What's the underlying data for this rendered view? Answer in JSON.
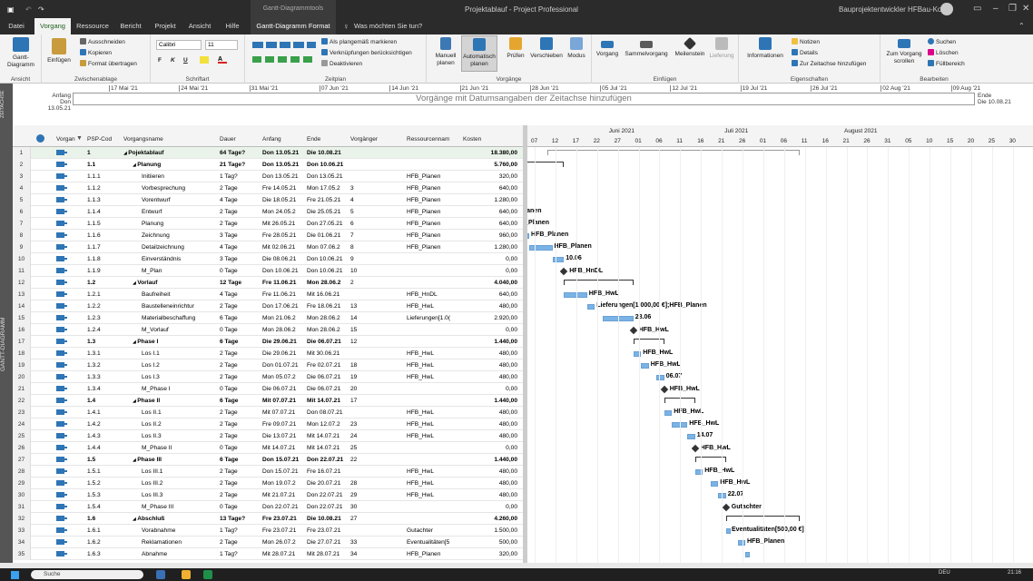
{
  "title_bar": {
    "context_label": "Gantt-Diagrammtools",
    "doc_title": "Projektablauf - Project Professional",
    "user": "Bauprojektentwickler HFBau-Kosel"
  },
  "tabs": [
    "Datei",
    "Vorgang",
    "Ressource",
    "Bericht",
    "Projekt",
    "Ansicht",
    "Hilfe",
    "Gantt-Diagramm Format"
  ],
  "tell_me": "Was möchten Sie tun?",
  "ribbon": {
    "ansicht": {
      "btn": "Gantt-Diagramm",
      "label": "Ansicht"
    },
    "zwischen": {
      "einfuegen": "Einfügen",
      "aus": "Ausschneiden",
      "kop": "Kopieren",
      "fmt": "Format übertragen",
      "label": "Zwischenablage"
    },
    "schrift": {
      "font": "Calibri",
      "size": "11",
      "b": "F",
      "i": "K",
      "u": "U",
      "label": "Schriftart"
    },
    "zeitplan": {
      "a": "Als plangemäß markieren",
      "b": "Verknüpfungen berücksichtigen",
      "c": "Deaktivieren",
      "label": "Zeitplan"
    },
    "vorgaenge": {
      "manuell": "Manuell planen",
      "auto": "Automatisch planen",
      "pruefen": "Prüfen",
      "versch": "Verschieben",
      "modus": "Modus",
      "label": "Vorgänge"
    },
    "einfuegen": {
      "vorgang": "Vorgang",
      "sammel": "Sammelvorgang",
      "meilen": "Meilenstein",
      "lief": "Lieferung",
      "label": "Einfügen"
    },
    "eigen": {
      "info": "Informationen",
      "notizen": "Notizen",
      "details": "Details",
      "zeit": "Zur Zeitachse hinzufügen",
      "label": "Eigenschaften"
    },
    "bearb": {
      "zum": "Zum Vorgang scrollen",
      "suchen": "Suchen",
      "loeschen": "Löschen",
      "fuell": "Füllbereich",
      "label": "Bearbeiten"
    }
  },
  "timeline": {
    "side": "ZEITACHSE",
    "anfang_label": "Anfang",
    "anfang": "Don 13.05.21",
    "ende_label": "Ende",
    "ende": "Die 10.08.21",
    "placeholder": "Vorgänge mit Datumsangaben der Zeitachse hinzufügen",
    "ticks": [
      "17 Mai '21",
      "24 Mai '21",
      "31 Mai '21",
      "07 Jun '21",
      "14 Jun '21",
      "21 Jun '21",
      "28 Jun '21",
      "05 Jul '21",
      "12 Jul '21",
      "19 Jul '21",
      "26 Jul '21",
      "02 Aug '21",
      "09 Aug '21"
    ]
  },
  "view_side": "GANTT-DIAGRAMM",
  "columns": [
    "Vorgan",
    "PSP-Cod",
    "Vorgangsname",
    "Dauer",
    "Anfang",
    "Ende",
    "Vorgänger",
    "Ressourcennam",
    "Kosten"
  ],
  "rows": [
    [
      "1",
      "1",
      "Pojektablauf",
      "64 Tage?",
      "Don 13.05.21",
      "Die 10.08.21",
      "",
      "",
      "18.380,00",
      0,
      1
    ],
    [
      "2",
      "1.1",
      "Planung",
      "21 Tage?",
      "Don 13.05.21",
      "Don 10.06.21",
      "",
      "",
      "5.760,00",
      1,
      1
    ],
    [
      "3",
      "1.1.1",
      "Initiieren",
      "1 Tag?",
      "Don 13.05.21",
      "Don 13.05.21",
      "",
      "HFB_Planen",
      "320,00",
      2,
      0
    ],
    [
      "4",
      "1.1.2",
      "Vorbesprechung",
      "2 Tage",
      "Fre 14.05.21",
      "Mon 17.05.2",
      "3",
      "HFB_Planen",
      "640,00",
      2,
      0
    ],
    [
      "5",
      "1.1.3",
      "Vorentwurf",
      "4 Tage",
      "Die 18.05.21",
      "Fre 21.05.21",
      "4",
      "HFB_Planen",
      "1.280,00",
      2,
      0
    ],
    [
      "6",
      "1.1.4",
      "Entwurf",
      "2 Tage",
      "Mon 24.05.2",
      "Die 25.05.21",
      "5",
      "HFB_Planen",
      "640,00",
      2,
      0
    ],
    [
      "7",
      "1.1.5",
      "Planung",
      "2 Tage",
      "Mit 26.05.21",
      "Don 27.05.21",
      "6",
      "HFB_Planen",
      "640,00",
      2,
      0
    ],
    [
      "8",
      "1.1.6",
      "Zeichnung",
      "3 Tage",
      "Fre 28.05.21",
      "Die 01.06.21",
      "7",
      "HFB_Planen",
      "960,00",
      2,
      0
    ],
    [
      "9",
      "1.1.7",
      "Detailzeichnung",
      "4 Tage",
      "Mit 02.06.21",
      "Mon 07.06.2",
      "8",
      "HFB_Planen",
      "1.280,00",
      2,
      0
    ],
    [
      "10",
      "1.1.8",
      "Einverständnis",
      "3 Tage",
      "Die 08.06.21",
      "Don 10.06.21",
      "9",
      "",
      "0,00",
      2,
      0
    ],
    [
      "11",
      "1.1.9",
      "M_Plan",
      "0 Tage",
      "Don 10.06.21",
      "Don 10.06.21",
      "10",
      "",
      "0,00",
      2,
      0
    ],
    [
      "12",
      "1.2",
      "Vorlauf",
      "12 Tage",
      "Fre 11.06.21",
      "Mon 28.06.2",
      "2",
      "",
      "4.040,00",
      1,
      1
    ],
    [
      "13",
      "1.2.1",
      "Baufreiheit",
      "4 Tage",
      "Fre 11.06.21",
      "Mit 16.06.21",
      "",
      "HFB_HnDL",
      "640,00",
      2,
      0
    ],
    [
      "14",
      "1.2.2",
      "Baustelleneinrichtur",
      "2 Tage",
      "Don 17.06.21",
      "Fre 18.06.21",
      "13",
      "HFB_HwL",
      "480,00",
      2,
      0
    ],
    [
      "15",
      "1.2.3",
      "Materialbeschaffung",
      "6 Tage",
      "Mon 21.06.2",
      "Mon 28.06.2",
      "14",
      "Lieferungen[1.0(",
      "2.920,00",
      2,
      0
    ],
    [
      "16",
      "1.2.4",
      "M_Vorlauf",
      "0 Tage",
      "Mon 28.06.2",
      "Mon 28.06.2",
      "15",
      "",
      "0,00",
      2,
      0
    ],
    [
      "17",
      "1.3",
      "Phase I",
      "6 Tage",
      "Die 29.06.21",
      "Die 06.07.21",
      "12",
      "",
      "1.440,00",
      1,
      1
    ],
    [
      "18",
      "1.3.1",
      "Los I.1",
      "2 Tage",
      "Die 29.06.21",
      "Mit 30.06.21",
      "",
      "HFB_HwL",
      "480,00",
      2,
      0
    ],
    [
      "19",
      "1.3.2",
      "Los I.2",
      "2 Tage",
      "Don 01.07.21",
      "Fre 02.07.21",
      "18",
      "HFB_HwL",
      "480,00",
      2,
      0
    ],
    [
      "20",
      "1.3.3",
      "Los I.3",
      "2 Tage",
      "Mon 05.07.2",
      "Die 06.07.21",
      "19",
      "HFB_HwL",
      "480,00",
      2,
      0
    ],
    [
      "21",
      "1.3.4",
      "M_Phase I",
      "0 Tage",
      "Die 06.07.21",
      "Die 06.07.21",
      "20",
      "",
      "0,00",
      2,
      0
    ],
    [
      "22",
      "1.4",
      "Phase II",
      "6 Tage",
      "Mit 07.07.21",
      "Mit 14.07.21",
      "17",
      "",
      "1.440,00",
      1,
      1
    ],
    [
      "23",
      "1.4.1",
      "Los II.1",
      "2 Tage",
      "Mit 07.07.21",
      "Don 08.07.21",
      "",
      "HFB_HwL",
      "480,00",
      2,
      0
    ],
    [
      "24",
      "1.4.2",
      "Los II.2",
      "2 Tage",
      "Fre 09.07.21",
      "Mon 12.07.2",
      "23",
      "HFB_HwL",
      "480,00",
      2,
      0
    ],
    [
      "25",
      "1.4.3",
      "Los II.3",
      "2 Tage",
      "Die 13.07.21",
      "Mit 14.07.21",
      "24",
      "HFB_HwL",
      "480,00",
      2,
      0
    ],
    [
      "26",
      "1.4.4",
      "M_Phase II",
      "0 Tage",
      "Mit 14.07.21",
      "Mit 14.07.21",
      "25",
      "",
      "0,00",
      2,
      0
    ],
    [
      "27",
      "1.5",
      "Phase III",
      "6 Tage",
      "Don 15.07.21",
      "Don 22.07.21",
      "22",
      "",
      "1.440,00",
      1,
      1
    ],
    [
      "28",
      "1.5.1",
      "Los III.1",
      "2 Tage",
      "Don 15.07.21",
      "Fre 16.07.21",
      "",
      "HFB_HwL",
      "480,00",
      2,
      0
    ],
    [
      "29",
      "1.5.2",
      "Los III.2",
      "2 Tage",
      "Mon 19.07.2",
      "Die 20.07.21",
      "28",
      "HFB_HwL",
      "480,00",
      2,
      0
    ],
    [
      "30",
      "1.5.3",
      "Los III.3",
      "2 Tage",
      "Mit 21.07.21",
      "Don 22.07.21",
      "29",
      "HFB_HwL",
      "480,00",
      2,
      0
    ],
    [
      "31",
      "1.5.4",
      "M_Phase III",
      "0 Tage",
      "Don 22.07.21",
      "Don 22.07.21",
      "30",
      "",
      "0,00",
      2,
      0
    ],
    [
      "32",
      "1.6",
      "Abschluß",
      "13 Tage?",
      "Fre 23.07.21",
      "Die 10.08.21",
      "27",
      "",
      "4.260,00",
      1,
      1
    ],
    [
      "33",
      "1.6.1",
      "Vorabnahme",
      "1 Tag?",
      "Fre 23.07.21",
      "Fre 23.07.21",
      "",
      "Gutachter",
      "1.500,00",
      2,
      0
    ],
    [
      "34",
      "1.6.2",
      "Reklamationen",
      "2 Tage",
      "Mon 26.07.2",
      "Die 27.07.21",
      "33",
      "Eventualitäten[5",
      "500,00",
      2,
      0
    ],
    [
      "35",
      "1.6.3",
      "Abnahme",
      "1 Tag?",
      "Mit 28.07.21",
      "Mit 28.07.21",
      "34",
      "HFB_Planen",
      "320,00",
      2,
      0
    ]
  ],
  "gantt": {
    "months": [
      "Juni 2021",
      "Juli 2021",
      "August 2021"
    ],
    "days": [
      "07",
      "12",
      "17",
      "22",
      "27",
      "01",
      "06",
      "11",
      "16",
      "21",
      "26",
      "01",
      "06",
      "11",
      "16",
      "21",
      "26",
      "31",
      "05",
      "10",
      "15",
      "20",
      "25",
      "30"
    ],
    "labels": [
      "HFB_Planen",
      "HFB_Planen",
      "HFB_Planen",
      "HFB_Planen",
      "HFB_Planen",
      "HFB_Planen",
      "HFB_Planen",
      "10.06",
      "HFB_HnDL",
      "HFB_HwL",
      "Lieferungen[1.000,00 €];HFB_Planen",
      "28.06",
      "HFB_HwL",
      "HFB_HwL",
      "HFB_HwL",
      "06.07",
      "HFB_HwL",
      "HFB_HwL",
      "HFB_HwL",
      "14.07",
      "HFB_HwL",
      "HFB_HwL",
      "HFB_HwL",
      "22.07",
      "Gutachter",
      "Eventualitäten[500,00 €]",
      "HFB_Planen"
    ]
  },
  "taskbar": {
    "search": "Suche",
    "lang": "DEU",
    "time": "21:16"
  }
}
